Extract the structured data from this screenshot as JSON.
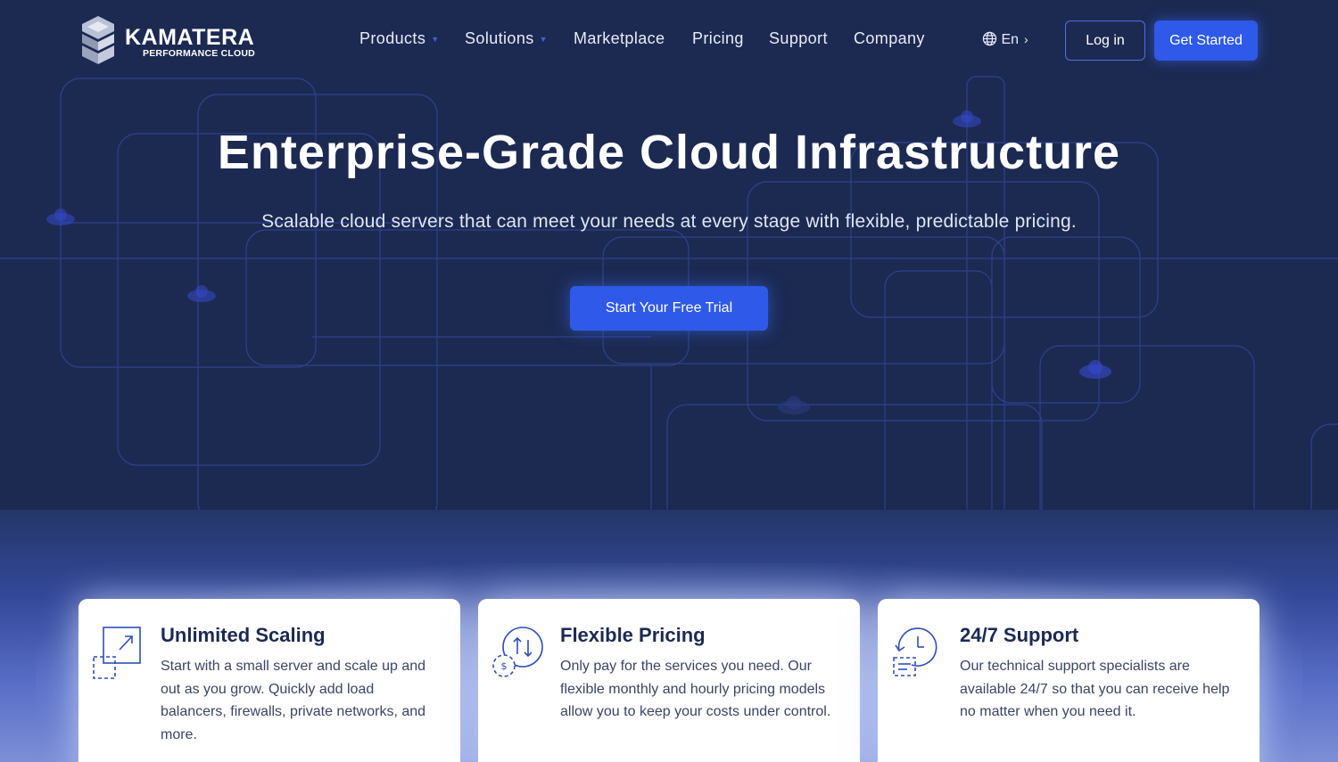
{
  "brand": {
    "name": "KAMATERA",
    "tagline": "PERFORMANCE CLOUD"
  },
  "nav": {
    "items": [
      {
        "label": "Products",
        "has_dropdown": true
      },
      {
        "label": "Solutions",
        "has_dropdown": true
      },
      {
        "label": "Marketplace",
        "has_dropdown": false
      },
      {
        "label": "Pricing",
        "has_dropdown": false
      },
      {
        "label": "Support",
        "has_dropdown": false
      },
      {
        "label": "Company",
        "has_dropdown": false
      }
    ],
    "language": "En",
    "language_icon": "globe-icon",
    "login_label": "Log in",
    "cta_label": "Get Started"
  },
  "hero": {
    "title": "Enterprise-Grade Cloud Infrastructure",
    "subtitle": "Scalable cloud servers that can meet your needs at every stage with flexible, predictable pricing.",
    "cta_label": "Start Your Free Trial"
  },
  "features": [
    {
      "icon": "scaling-icon",
      "title": "Unlimited Scaling",
      "text": "Start with a small server and scale up and out as you grow. Quickly add load balancers, firewalls, private networks, and more."
    },
    {
      "icon": "pricing-icon",
      "title": "Flexible Pricing",
      "text": "Only pay for the services you need. Our flexible monthly and hourly pricing models allow you to keep your costs under control."
    },
    {
      "icon": "support-icon",
      "title": "24/7 Support",
      "text": "Our technical support specialists are available 24/7 so that you can receive help no matter when you need it."
    }
  ],
  "colors": {
    "hero_bg": "#1c2a52",
    "accent": "#2e59e9",
    "line": "#3e54b8",
    "card_title": "#1c2a52"
  }
}
